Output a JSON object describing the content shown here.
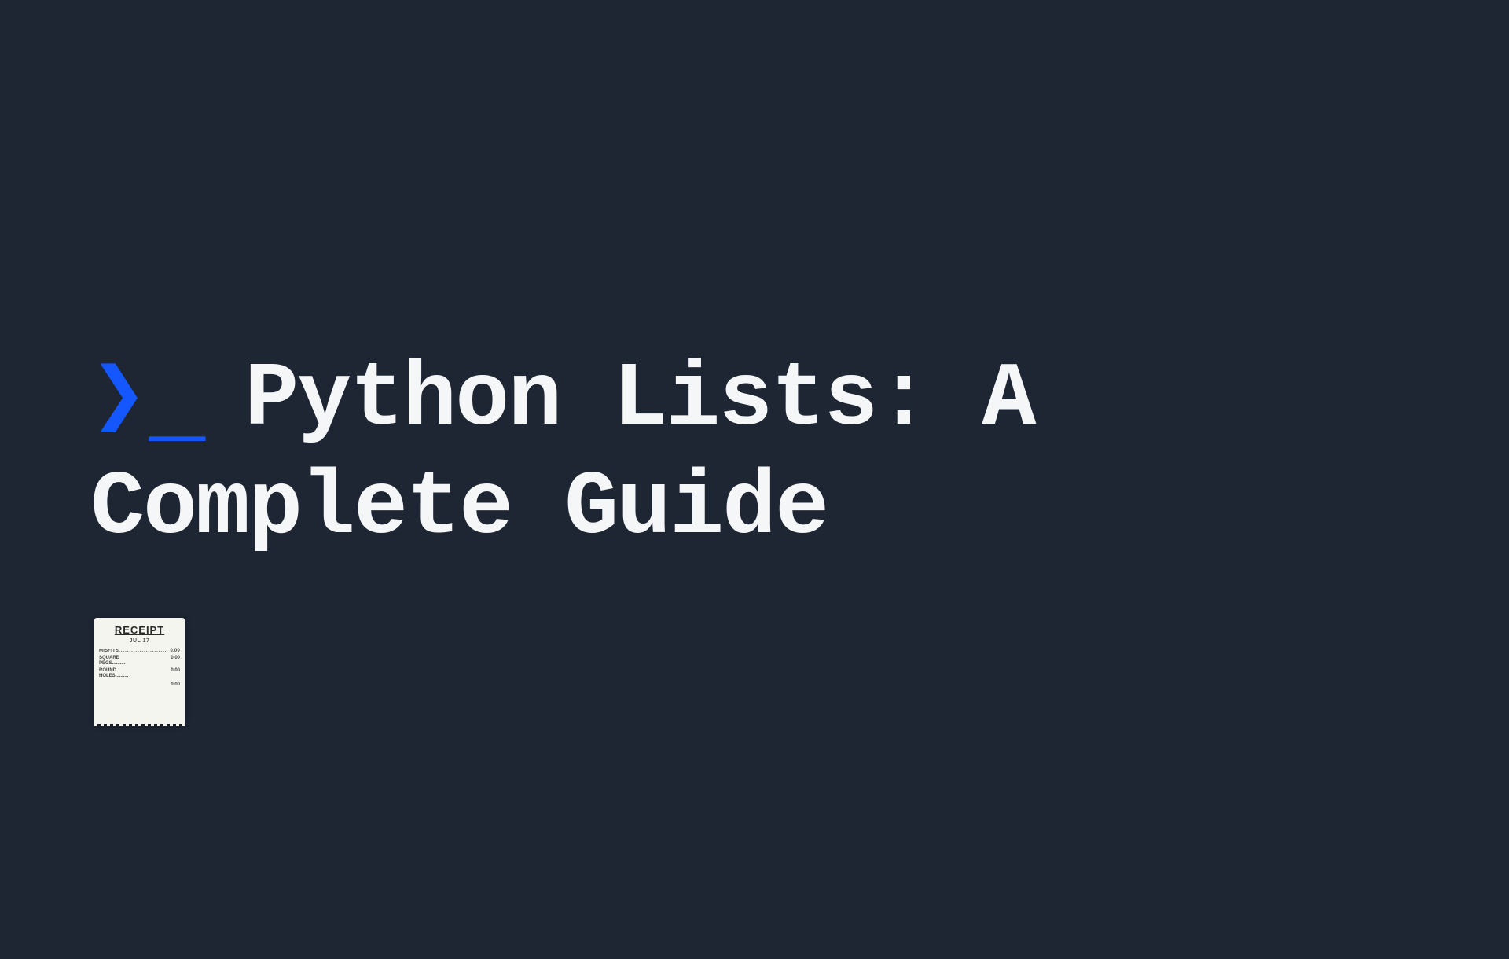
{
  "title": {
    "line1": "Python Lists: A",
    "line2": "Complete Guide"
  },
  "receipt": {
    "header": "RECEIPT",
    "date": "JUL 17",
    "lines": [
      {
        "label": "MISFITS",
        "value": "0.00"
      },
      {
        "label_multi": [
          "SQUARE",
          "PEGS"
        ],
        "value": "0.00"
      },
      {
        "label_multi": [
          "ROUND",
          "HOLES"
        ],
        "value": "0.00"
      }
    ],
    "total": "0.00"
  }
}
